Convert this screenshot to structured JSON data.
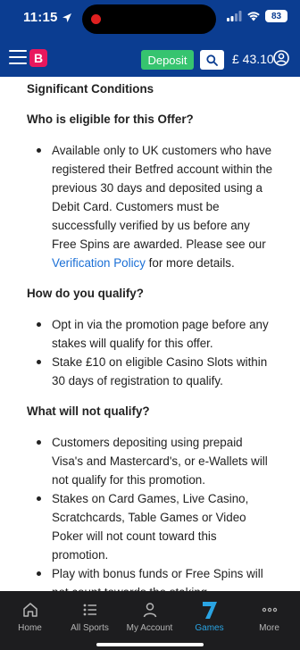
{
  "status_bar": {
    "time": "11:15",
    "battery": "83"
  },
  "header": {
    "logo_text": "B",
    "deposit_label": "Deposit",
    "balance": "£ 43.10"
  },
  "content": {
    "significant_conditions": "Significant Conditions",
    "eligible_heading": "Who is eligible for this Offer?",
    "eligible_text": "Available only to UK customers who have registered their Betfred account within the previous 30 days and deposited using a Debit Card. Customers must be successfully verified by us before any Free Spins are awarded. Please see our ",
    "verification_link": "Verification Policy",
    "eligible_suffix": " for more details.",
    "qualify_heading": "How do you qualify?",
    "qualify_items": [
      "Opt in via the promotion page before any stakes will qualify for this offer.",
      "Stake £10 on eligible Casino Slots within 30 days of registration to qualify."
    ],
    "not_qualify_heading": "What will not qualify?",
    "not_qualify_items": [
      "Customers depositing using prepaid Visa's and Mastercard's, or e-Wallets will not qualify for this promotion.",
      "Stakes on Card Games, Live Casino, Scratchcards, Table Games or Video Poker will not count toward this promotion.",
      "Play with bonus funds or Free Spins will not count towards the staking"
    ]
  },
  "bottom_nav": [
    {
      "label": "Home",
      "icon": "home-icon"
    },
    {
      "label": "All Sports",
      "icon": "list-icon"
    },
    {
      "label": "My Account",
      "icon": "person-icon"
    },
    {
      "label": "Games",
      "icon": "games-7-icon",
      "active": true
    },
    {
      "label": "More",
      "icon": "more-dots-icon"
    }
  ],
  "colors": {
    "header_bg": "#0b3d91",
    "deposit_green": "#36c46f",
    "logo_pink": "#e8175d",
    "link_blue": "#1a6fd6",
    "nav_bg": "#1d1d1f",
    "nav_active": "#2aa4e3"
  }
}
